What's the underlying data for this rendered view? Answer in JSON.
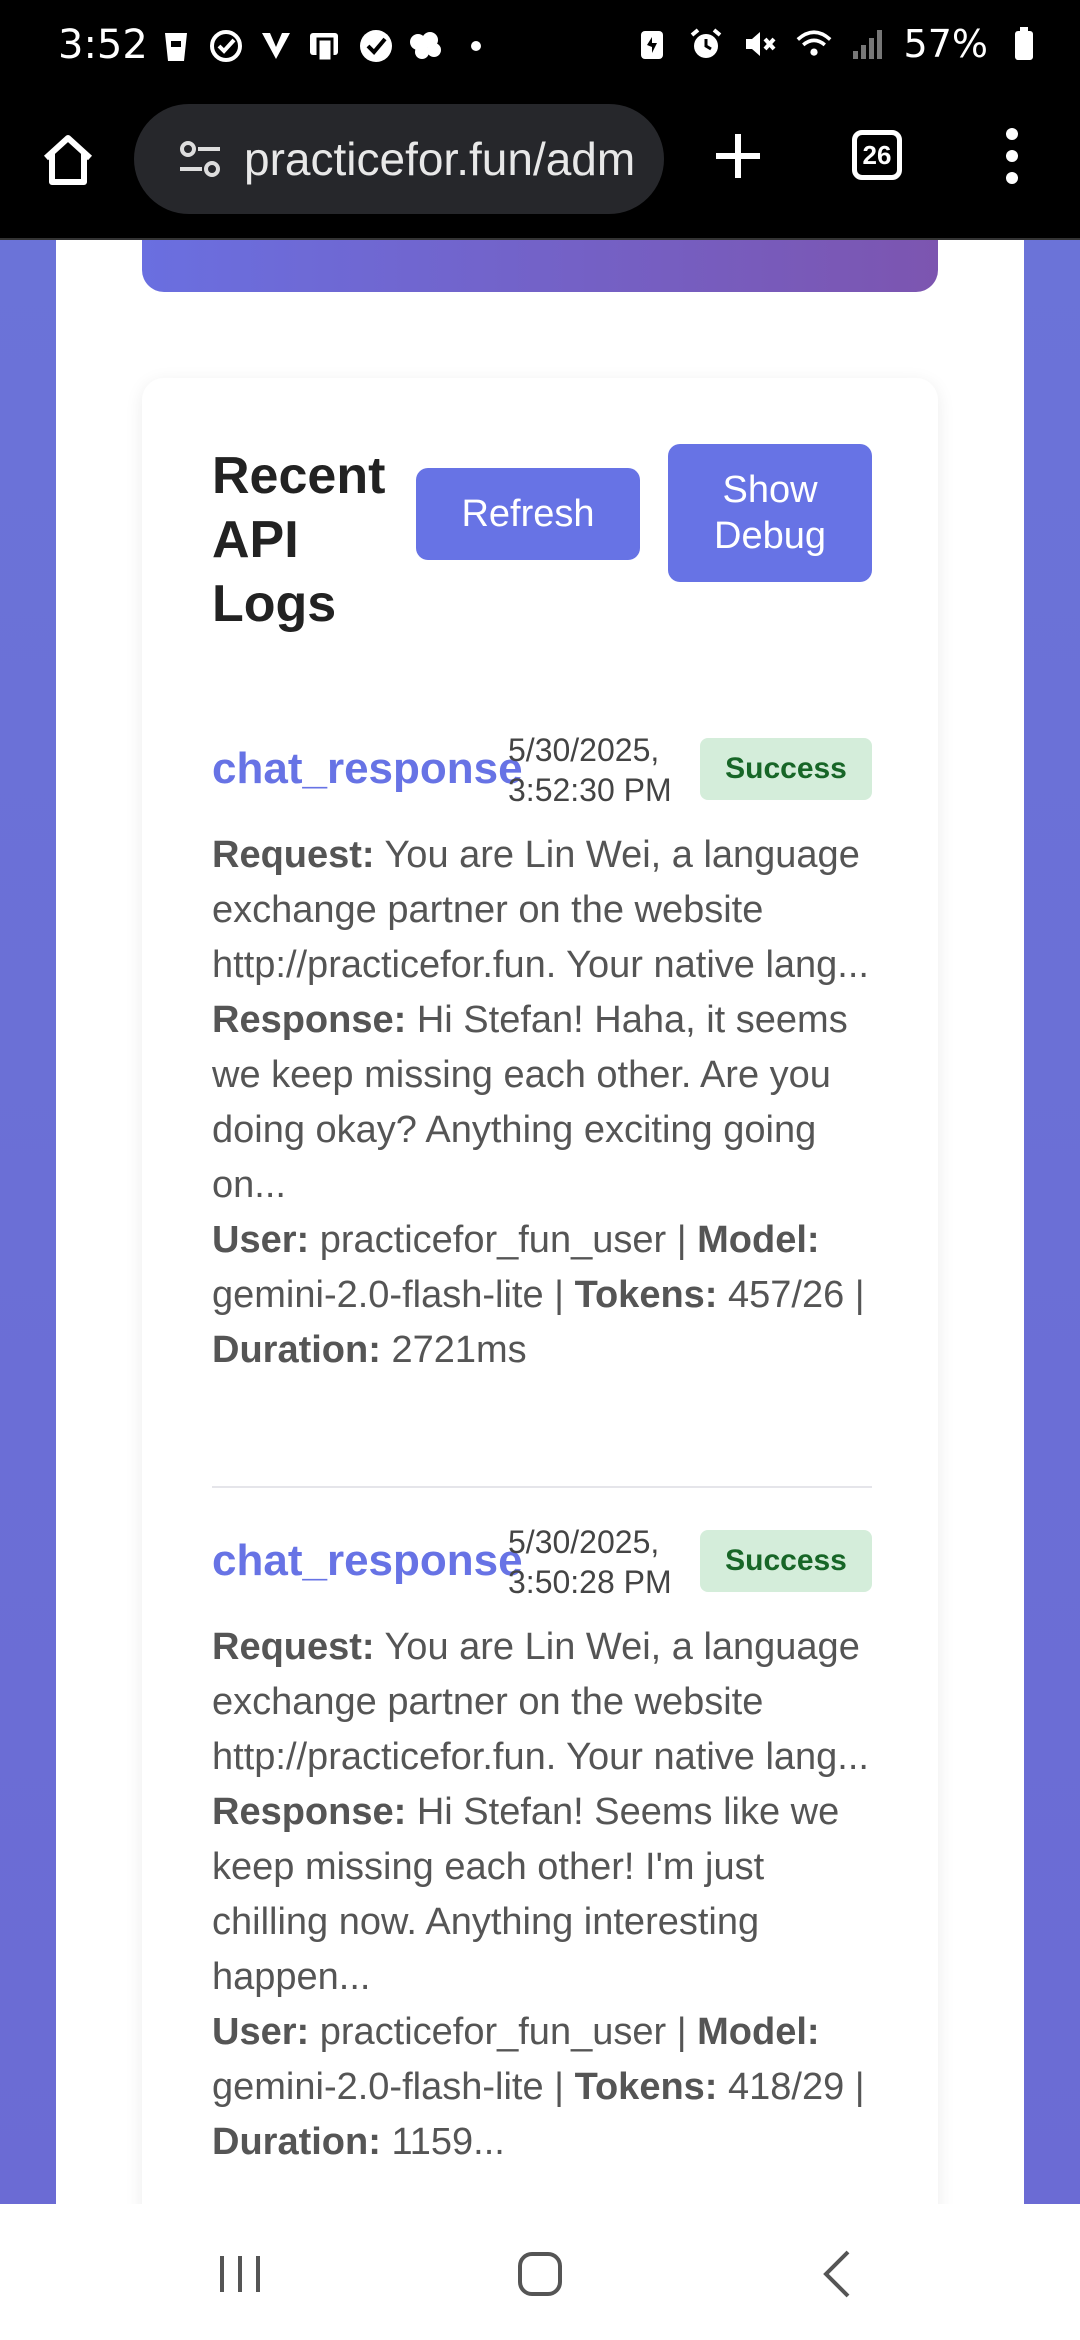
{
  "status_bar": {
    "time": "3:52",
    "battery": "57%",
    "left_icons": [
      "starbucks-icon",
      "check-circle-icon",
      "v-icon",
      "wallet-icon",
      "verified-icon",
      "brain-icon",
      "dot-icon"
    ],
    "right_icons": [
      "battery-saver-icon",
      "alarm-icon",
      "mute-icon",
      "wifi-icon",
      "signal-icon",
      "battery-icon"
    ]
  },
  "browser": {
    "url": "practicefor.fun/adm",
    "tab_count": "26"
  },
  "logs": {
    "title": "Recent API Logs",
    "refresh_label": "Refresh",
    "debug_label": "Show Debug",
    "entries": [
      {
        "type": "chat_response",
        "date": "5/30/2025,",
        "time": "3:52:30 PM",
        "status": "Success",
        "request_label": "Request:",
        "request": "You are Lin Wei, a language exchange partner on the website http://practicefor.fun. Your native lang...",
        "response_label": "Response:",
        "response": "Hi Stefan! Haha, it seems we keep missing each other. Are you doing okay? Anything exciting going on...",
        "user_label": "User:",
        "user": "practicefor_fun_user",
        "model_label": "Model:",
        "model": "gemini-2.0-flash-lite",
        "tokens_label": "Tokens:",
        "tokens": "457/26",
        "duration_label": "Duration:",
        "duration": "2721ms"
      },
      {
        "type": "chat_response",
        "date": "5/30/2025,",
        "time": "3:50:28 PM",
        "status": "Success",
        "request_label": "Request:",
        "request": "You are Lin Wei, a language exchange partner on the website http://practicefor.fun. Your native lang...",
        "response_label": "Response:",
        "response": "Hi Stefan! Seems like we keep missing each other! I'm just chilling now. Anything interesting happen...",
        "user_label": "User:",
        "user": "practicefor_fun_user",
        "model_label": "Model:",
        "model": "gemini-2.0-flash-lite",
        "tokens_label": "Tokens:",
        "tokens": "418/29",
        "duration_label": "Duration:",
        "duration": "1159..."
      }
    ]
  },
  "colors": {
    "accent": "#6773e5",
    "success_bg": "#d4edda",
    "success_text": "#176627",
    "page_bg": "#6b73d8"
  }
}
